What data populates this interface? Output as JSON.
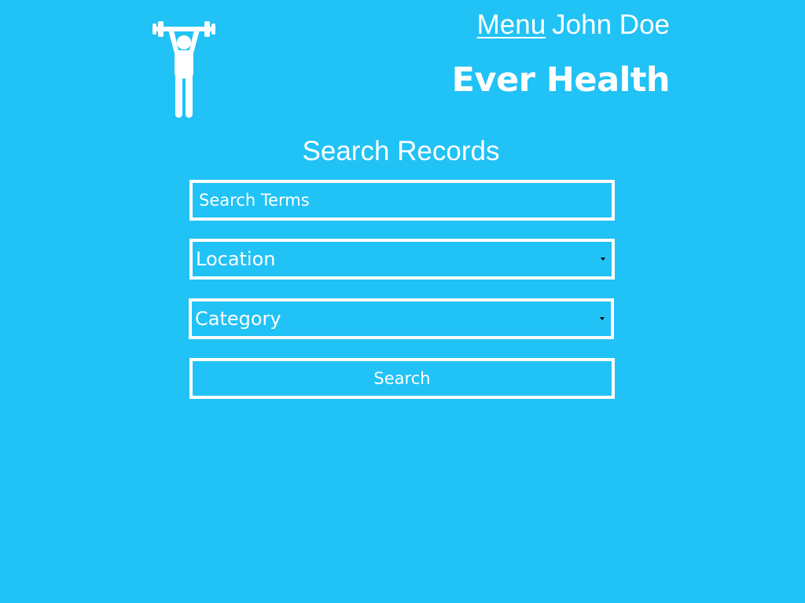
{
  "header": {
    "logo_icon": "weightlifter-icon",
    "menu_label": "Menu",
    "user_name": "John Doe",
    "brand": "Ever Health"
  },
  "main": {
    "title": "Search Records",
    "search_placeholder": "Search Terms",
    "location_select": {
      "selected": "Location",
      "icon": "caret-down-icon"
    },
    "category_select": {
      "selected": "Category",
      "icon": "caret-down-icon"
    },
    "search_button_label": "Search"
  },
  "colors": {
    "background": "#21c2f6",
    "foreground": "#ffffff"
  }
}
